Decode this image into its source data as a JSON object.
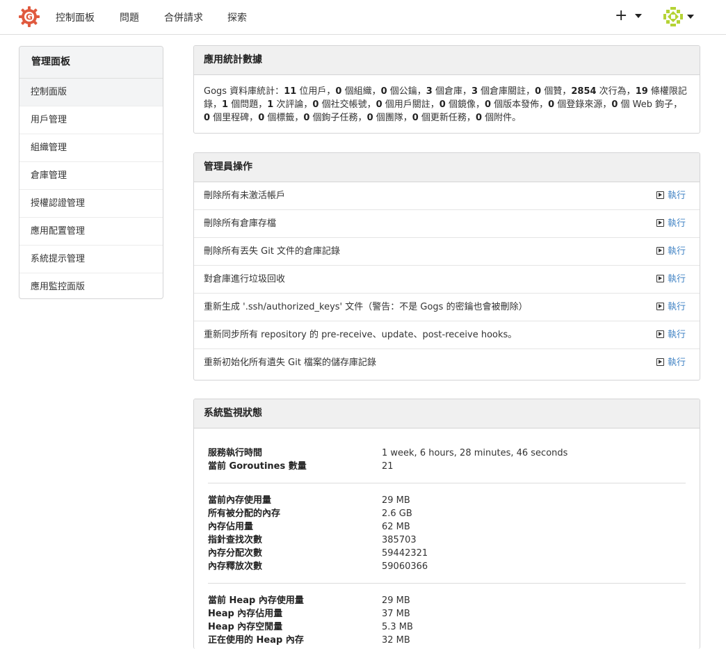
{
  "nav": {
    "items": [
      "控制面板",
      "問題",
      "合併請求",
      "探索"
    ],
    "plus": "+"
  },
  "sidebar": {
    "title": "管理面板",
    "items": [
      {
        "label": "控制面版"
      },
      {
        "label": "用戶管理"
      },
      {
        "label": "組織管理"
      },
      {
        "label": "倉庫管理"
      },
      {
        "label": "授權認證管理"
      },
      {
        "label": "應用配置管理"
      },
      {
        "label": "系統提示管理"
      },
      {
        "label": "應用監控面版"
      }
    ]
  },
  "stats": {
    "title": "應用統計數據",
    "prefix": "Gogs 資料庫統計：",
    "parts": [
      {
        "n": "11",
        "t": " 位用戶，"
      },
      {
        "n": "0",
        "t": " 個組織，"
      },
      {
        "n": "0",
        "t": " 個公鑰，"
      },
      {
        "n": "3",
        "t": " 個倉庫，"
      },
      {
        "n": "3",
        "t": " 個倉庫關註，"
      },
      {
        "n": "0",
        "t": " 個贊，"
      },
      {
        "n": "2854",
        "t": " 次行為，"
      },
      {
        "n": "19",
        "t": " 條權限記錄，"
      },
      {
        "n": "1",
        "t": " 個問題，"
      },
      {
        "n": "1",
        "t": " 次評論，"
      },
      {
        "n": "0",
        "t": " 個社交帳號，"
      },
      {
        "n": "0",
        "t": " 個用戶關註，"
      },
      {
        "n": "0",
        "t": " 個鏡像，"
      },
      {
        "n": "0",
        "t": " 個版本發佈，"
      },
      {
        "n": "0",
        "t": " 個登錄來源，"
      },
      {
        "n": "0",
        "t": " 個 Web 鉤子，"
      },
      {
        "n": "0",
        "t": " 個里程碑，"
      },
      {
        "n": "0",
        "t": " 個標籤，"
      },
      {
        "n": "0",
        "t": " 個鉤子任務，"
      },
      {
        "n": "0",
        "t": " 個團隊，"
      },
      {
        "n": "0",
        "t": " 個更新任務，"
      },
      {
        "n": "0",
        "t": " 個附件。"
      }
    ]
  },
  "ops": {
    "title": "管理員操作",
    "run_label": "執行",
    "items": [
      "刪除所有未激活帳戶",
      "刪除所有倉庫存檔",
      "刪除所有丟失 Git 文件的倉庫記錄",
      "對倉庫進行垃圾回收",
      "重新生成 '.ssh/authorized_keys' 文件（警告：不是 Gogs 的密鑰也會被刪除）",
      "重新同步所有 repository 的 pre-receive、update、post-receive hooks。",
      "重新初始化所有遺失 Git 檔案的儲存庫記錄"
    ]
  },
  "monitor": {
    "title": "系統監視狀態",
    "groups": [
      [
        {
          "label": "服務執行時間",
          "value": "1 week, 6 hours, 28 minutes, 46 seconds"
        },
        {
          "label": "當前 Goroutines 數量",
          "value": "21"
        }
      ],
      [
        {
          "label": "當前內存使用量",
          "value": "29 MB"
        },
        {
          "label": "所有被分配的內存",
          "value": "2.6 GB"
        },
        {
          "label": "內存佔用量",
          "value": "62 MB"
        },
        {
          "label": "指針查找次數",
          "value": "385703"
        },
        {
          "label": "內存分配次數",
          "value": "59442321"
        },
        {
          "label": "內存釋放次數",
          "value": "59060366"
        }
      ],
      [
        {
          "label": "當前 Heap 內存使用量",
          "value": "29 MB"
        },
        {
          "label": "Heap 內存佔用量",
          "value": "37 MB"
        },
        {
          "label": "Heap 內存空閒量",
          "value": "5.3 MB"
        },
        {
          "label": "正在使用的 Heap 內存",
          "value": "32 MB"
        }
      ]
    ]
  },
  "colors": {
    "accent": "#4183c4",
    "logo": "#e05a3f",
    "avatar": "#b5d335"
  }
}
